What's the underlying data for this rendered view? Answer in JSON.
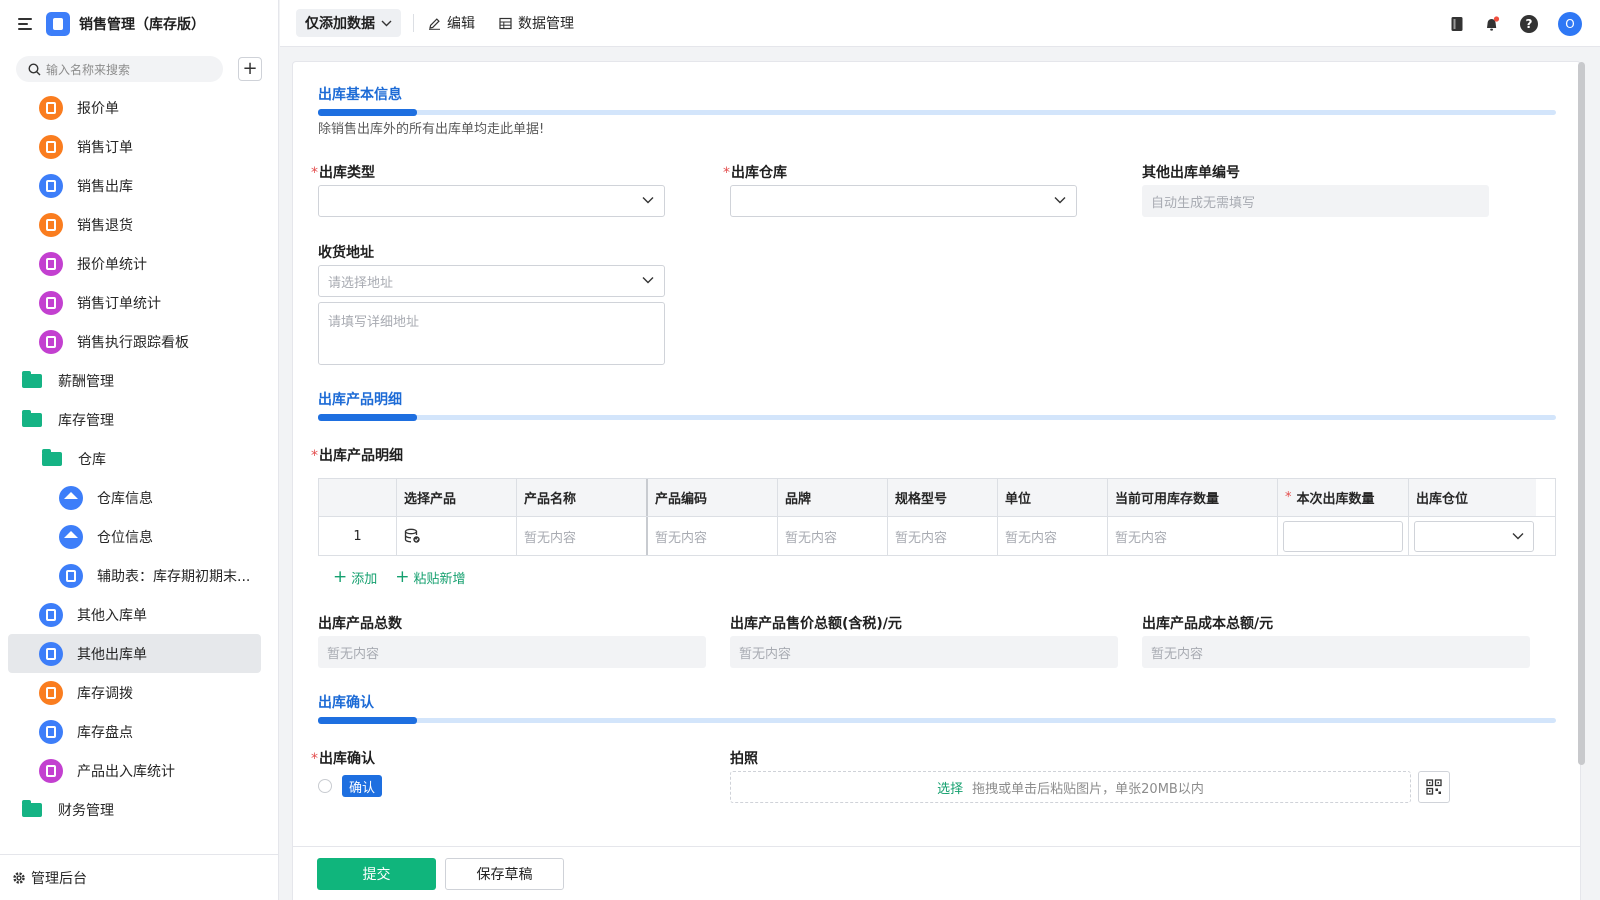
{
  "app": {
    "title": "销售管理（库存版）"
  },
  "sidebar": {
    "search_placeholder": "输入名称来搜索",
    "items": [
      {
        "label": "报价单",
        "icon": "orange"
      },
      {
        "label": "销售订单",
        "icon": "orange"
      },
      {
        "label": "销售出库",
        "icon": "blue"
      },
      {
        "label": "销售退货",
        "icon": "orange"
      },
      {
        "label": "报价单统计",
        "icon": "purple"
      },
      {
        "label": "销售订单统计",
        "icon": "purple"
      },
      {
        "label": "销售执行跟踪看板",
        "icon": "purple"
      },
      {
        "label": "薪酬管理",
        "icon": "folder"
      },
      {
        "label": "库存管理",
        "icon": "folder-open"
      },
      {
        "label": "仓库",
        "icon": "folder-open"
      },
      {
        "label": "仓库信息",
        "icon": "home"
      },
      {
        "label": "仓位信息",
        "icon": "home"
      },
      {
        "label": "辅助表：库存期初期末...",
        "icon": "blue"
      },
      {
        "label": "其他入库单",
        "icon": "blue"
      },
      {
        "label": "其他出库单",
        "icon": "blue",
        "active": true
      },
      {
        "label": "库存调拨",
        "icon": "orange"
      },
      {
        "label": "库存盘点",
        "icon": "blue"
      },
      {
        "label": "产品出入库统计",
        "icon": "purple"
      },
      {
        "label": "财务管理",
        "icon": "folder"
      }
    ],
    "footer_label": "管理后台"
  },
  "topbar": {
    "mode_label": "仅添加数据",
    "edit_label": "编辑",
    "data_manage_label": "数据管理",
    "avatar_initial": "O"
  },
  "form": {
    "section1": {
      "title": "出库基本信息",
      "desc": "除销售出库外的所有出库单均走此单据!"
    },
    "outbound_type": {
      "label": "出库类型",
      "required": true,
      "value": ""
    },
    "outbound_warehouse": {
      "label": "出库仓库",
      "required": true,
      "value": ""
    },
    "other_no": {
      "label": "其他出库单编号",
      "placeholder": "自动生成无需填写"
    },
    "address": {
      "label": "收货地址",
      "select_placeholder": "请选择地址",
      "detail_placeholder": "请填写详细地址"
    },
    "section2": {
      "title": "出库产品明细"
    },
    "detail_table": {
      "label": "出库产品明细",
      "required": true,
      "columns": [
        "选择产品",
        "产品名称",
        "产品编码",
        "品牌",
        "规格型号",
        "单位",
        "当前可用库存数量",
        "本次出库数量",
        "出库仓位"
      ],
      "rows": [
        {
          "index": "1",
          "name": "暂无内容",
          "code": "暂无内容",
          "brand": "暂无内容",
          "spec": "暂无内容",
          "unit": "暂无内容",
          "stock": "暂无内容"
        }
      ],
      "add_label": "添加",
      "paste_label": "粘贴新增"
    },
    "totals": {
      "count": {
        "label": "出库产品总数",
        "value": "暂无内容"
      },
      "sale_amount": {
        "label": "出库产品售价总额(含税)/元",
        "value": "暂无内容"
      },
      "cost_amount": {
        "label": "出库产品成本总额/元",
        "value": "暂无内容"
      }
    },
    "section3": {
      "title": "出库确认"
    },
    "confirm": {
      "label": "出库确认",
      "required": true,
      "option": "确认"
    },
    "photo": {
      "label": "拍照",
      "select_label": "选择",
      "hint": "拖拽或单击后粘贴图片，单张20MB以内"
    }
  },
  "footer": {
    "submit_label": "提交",
    "draft_label": "保存草稿"
  },
  "colors": {
    "primary": "#1e6fe0",
    "success": "#10b57c",
    "orange": "#fa7d1f",
    "purple": "#c340d0",
    "folder": "#15b384"
  }
}
